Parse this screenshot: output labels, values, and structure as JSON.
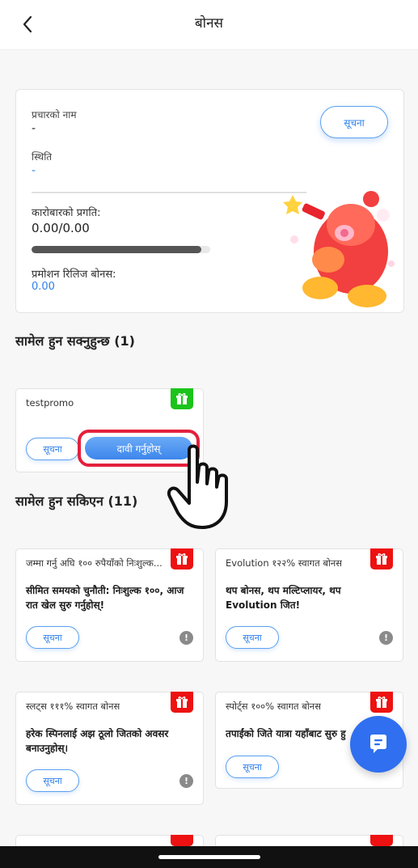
{
  "header": {
    "title": "बोनस"
  },
  "summary": {
    "promo_name_label": "प्रचारको नाम",
    "promo_name_value": "-",
    "status_label": "स्थिति",
    "status_value": "-",
    "notice_button": "सूचना",
    "turnover_label": "कारोबारको प्रगति:",
    "turnover_value": "0.00/0.00",
    "turnover_progress": 0.95,
    "release_label": "प्रमोशन रिलिज बोनस:",
    "release_value": "0.00"
  },
  "joinable": {
    "title": "सामेल हुन सक्नुहुन्छ (1)",
    "cards": [
      {
        "name": "testpromo",
        "notice_button": "सूचना",
        "claim_button": "दावी गर्नुहोस्"
      }
    ]
  },
  "unavailable": {
    "title": "सामेल हुन सकिएन (11)",
    "cards": [
      {
        "name": "जम्मा गर्नु अघि १०० रुपैयाँको निःशुल्क...",
        "desc": "सीमित समयको चुनौती: निःशुल्क १००, आज रात खेल सुरु गर्नुहोस्!",
        "notice_button": "सूचना"
      },
      {
        "name": "Evolution १२२% स्वागत बोनस",
        "desc": "थप बोनस, थप मल्टिप्लायर, थप Evolution जित!",
        "notice_button": "सूचना"
      },
      {
        "name": "स्लट्स १११% स्वागत बोनस",
        "desc": "हरेक स्पिनलाई अझ ठूलो जितको अवसर बनाउनुहोस्।",
        "notice_button": "सूचना"
      },
      {
        "name": "स्पोर्ट्स १००% स्वागत बोनस",
        "desc": "तपाईंको जिते यात्रा यहाँबाट सुरु हु",
        "notice_button": "सूचना"
      }
    ]
  },
  "colors": {
    "accent": "#2f80ed",
    "gift_green": "#1bc41b",
    "gift_red": "#ee1111",
    "highlight": "#e3213d",
    "fab": "#2f6ff0"
  },
  "icons": {
    "back": "chevron-left-icon",
    "gift": "gift-icon",
    "info": "info-icon",
    "chat": "chat-icon",
    "hand": "pointing-hand-icon"
  }
}
